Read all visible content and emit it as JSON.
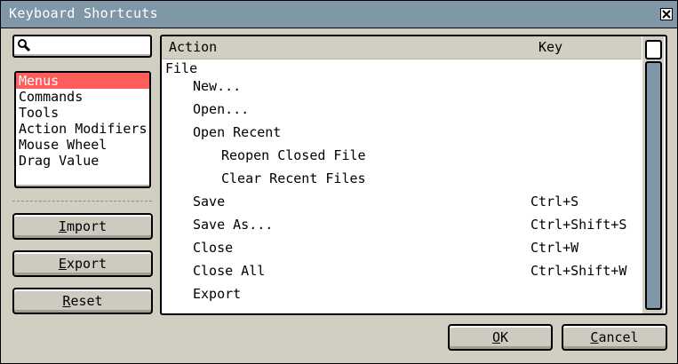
{
  "window": {
    "title": "Keyboard Shortcuts"
  },
  "search": {
    "value": "",
    "placeholder": ""
  },
  "categories": [
    {
      "label": "Menus",
      "selected": true
    },
    {
      "label": "Commands",
      "selected": false
    },
    {
      "label": "Tools",
      "selected": false
    },
    {
      "label": "Action Modifiers",
      "selected": false
    },
    {
      "label": "Mouse Wheel",
      "selected": false
    },
    {
      "label": "Drag Value",
      "selected": false
    }
  ],
  "side_buttons": {
    "import_label": "Import",
    "export_label": "Export",
    "reset_label": "Reset"
  },
  "table": {
    "col_action": "Action",
    "col_key": "Key",
    "rows": [
      {
        "action": "File",
        "key": "",
        "level": 0
      },
      {
        "action": "New...",
        "key": "",
        "level": 1
      },
      {
        "action": "Open...",
        "key": "",
        "level": 1
      },
      {
        "action": "Open Recent",
        "key": "",
        "level": 1
      },
      {
        "action": "Reopen Closed File",
        "key": "",
        "level": 2
      },
      {
        "action": "Clear Recent Files",
        "key": "",
        "level": 2
      },
      {
        "action": "Save",
        "key": "Ctrl+S",
        "level": 1
      },
      {
        "action": "Save As...",
        "key": "Ctrl+Shift+S",
        "level": 1
      },
      {
        "action": "Close",
        "key": "Ctrl+W",
        "level": 1
      },
      {
        "action": "Close All",
        "key": "Ctrl+Shift+W",
        "level": 1
      },
      {
        "action": "Export",
        "key": "",
        "level": 1
      }
    ]
  },
  "footer": {
    "ok_label": "OK",
    "cancel_label": "Cancel"
  },
  "colors": {
    "titlebar": "#7f97a6",
    "dialog_bg": "#d3cec2",
    "selection": "#ff5c5c"
  },
  "icons": {
    "search": "search-icon",
    "close": "close-icon"
  }
}
